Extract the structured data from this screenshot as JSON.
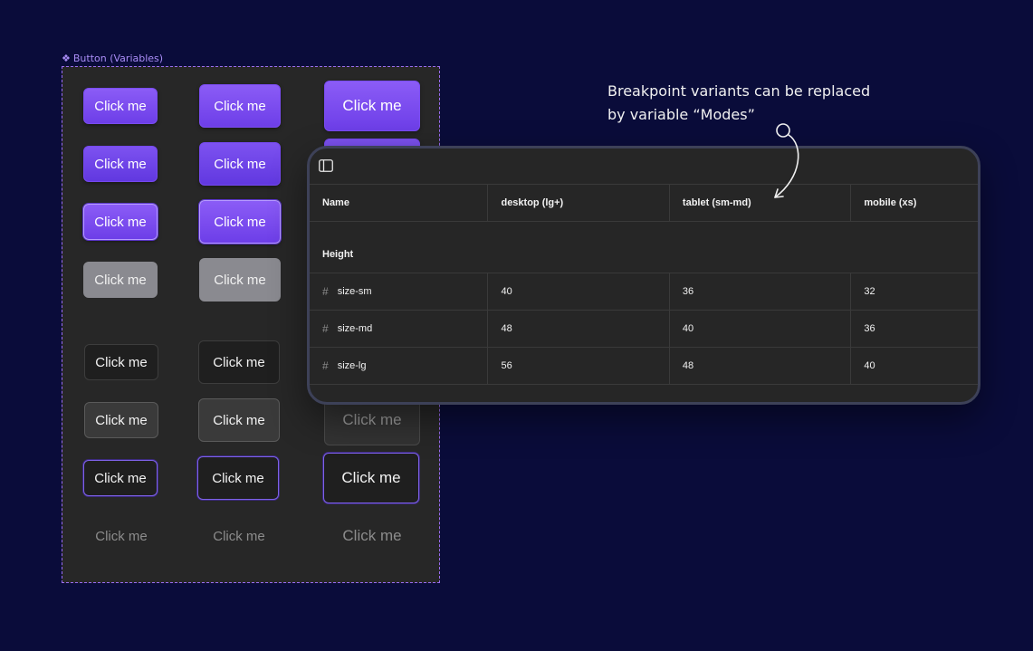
{
  "component": {
    "label": "Button (Variables)",
    "icon": "component-icon"
  },
  "button_label": "Click me",
  "annotation": {
    "line1": "Breakpoint variants can be replaced",
    "line2": "by variable “Modes”"
  },
  "variables_table": {
    "columns": [
      "Name",
      "desktop (lg+)",
      "tablet (sm-md)",
      "mobile (xs)"
    ],
    "group": "Height",
    "rows": [
      {
        "name": "size-sm",
        "values": [
          "40",
          "36",
          "32"
        ]
      },
      {
        "name": "size-md",
        "values": [
          "48",
          "40",
          "36"
        ]
      },
      {
        "name": "size-lg",
        "values": [
          "56",
          "48",
          "40"
        ]
      }
    ]
  },
  "colors": {
    "background": "#0a0c3a",
    "accent": "#7c4dff",
    "frame_border": "#9a6cf2",
    "panel": "#262626"
  }
}
